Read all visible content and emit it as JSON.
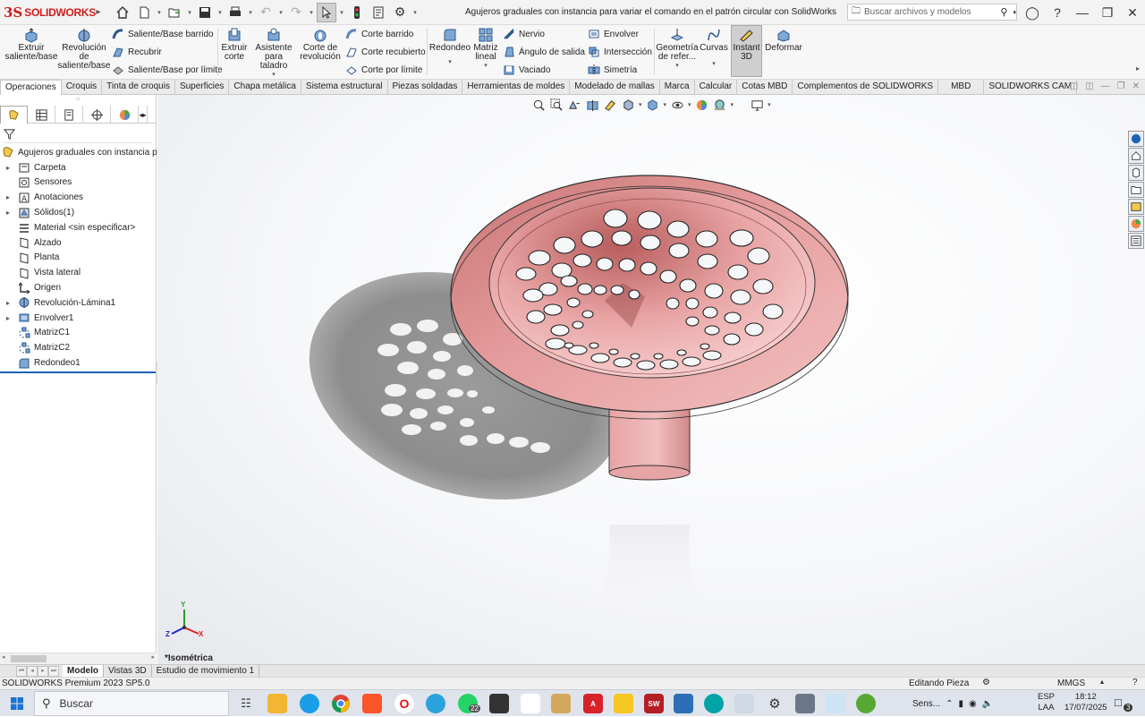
{
  "app": {
    "brand_prefix": "3S",
    "brand_name": "SOLIDWORKS",
    "document_title": "Agujeros graduales con instancia para variar el comando en el patrón circular con SolidWorks",
    "search_placeholder": "Buscar archivos y modelos"
  },
  "ribbon": {
    "extruir_saliente": "Extruir saliente/base",
    "revolucion_saliente": "Revolución de saliente/base",
    "saliente_barrido": "Saliente/Base barrido",
    "recubrir": "Recubrir",
    "saliente_limite": "Saliente/Base por límite",
    "extruir_corte": "Extruir corte",
    "asistente_taladro": "Asistente para taladro",
    "corte_revolucion": "Corte de revolución",
    "corte_barrido": "Corte barrido",
    "corte_recubierto": "Corte recubierto",
    "corte_limite": "Corte por límite",
    "redondeo": "Redondeo",
    "matriz_lineal": "Matriz lineal",
    "nervio": "Nervio",
    "angulo_salida": "Ángulo de salida",
    "vaciado": "Vaciado",
    "envolver": "Envolver",
    "interseccion": "Intersección",
    "simetria": "Simetría",
    "geometria_ref": "Geometría de refer...",
    "curvas": "Curvas",
    "instant3d": "Instant 3D",
    "deformar": "Deformar"
  },
  "tabs": [
    "Operaciones",
    "Croquis",
    "Tinta de croquis",
    "Superficies",
    "Chapa metálica",
    "Sistema estructural",
    "Piezas soldadas",
    "Herramientas de moldes",
    "Modelado de mallas",
    "Marca",
    "Calcular",
    "Cotas MBD",
    "Complementos de SOLIDWORKS",
    "MBD",
    "SOLIDWORKS CAM"
  ],
  "tree": {
    "root": "Agujeros graduales con instancia para",
    "items": [
      "Carpeta",
      "Sensores",
      "Anotaciones",
      "Sólidos(1)",
      "Material <sin especificar>",
      "Alzado",
      "Planta",
      "Vista lateral",
      "Origen",
      "Revolución-Lámina1",
      "Envolver1",
      "MatrizC1",
      "MatrizC2",
      "Redondeo1"
    ]
  },
  "viewport": {
    "view_name": "*Isométrica",
    "axis_x": "X",
    "axis_y": "Y",
    "axis_z": "Z"
  },
  "bottom_tabs": [
    "Modelo",
    "Vistas 3D",
    "Estudio de movimiento 1"
  ],
  "status": {
    "product": "SOLIDWORKS Premium 2023 SP5.0",
    "mode": "Editando Pieza",
    "units": "MMGS"
  },
  "taskbar": {
    "search_label": "Buscar",
    "tray_label": "Sens...",
    "lang_top": "ESP",
    "lang_bottom": "LAA",
    "time": "18:12",
    "date": "17/07/2025",
    "notif_count": "3",
    "whatsapp_badge": "22"
  },
  "colors": {
    "brand": "#d11c1c",
    "part": "#e89a9a",
    "rollback": "#1d63b3"
  }
}
